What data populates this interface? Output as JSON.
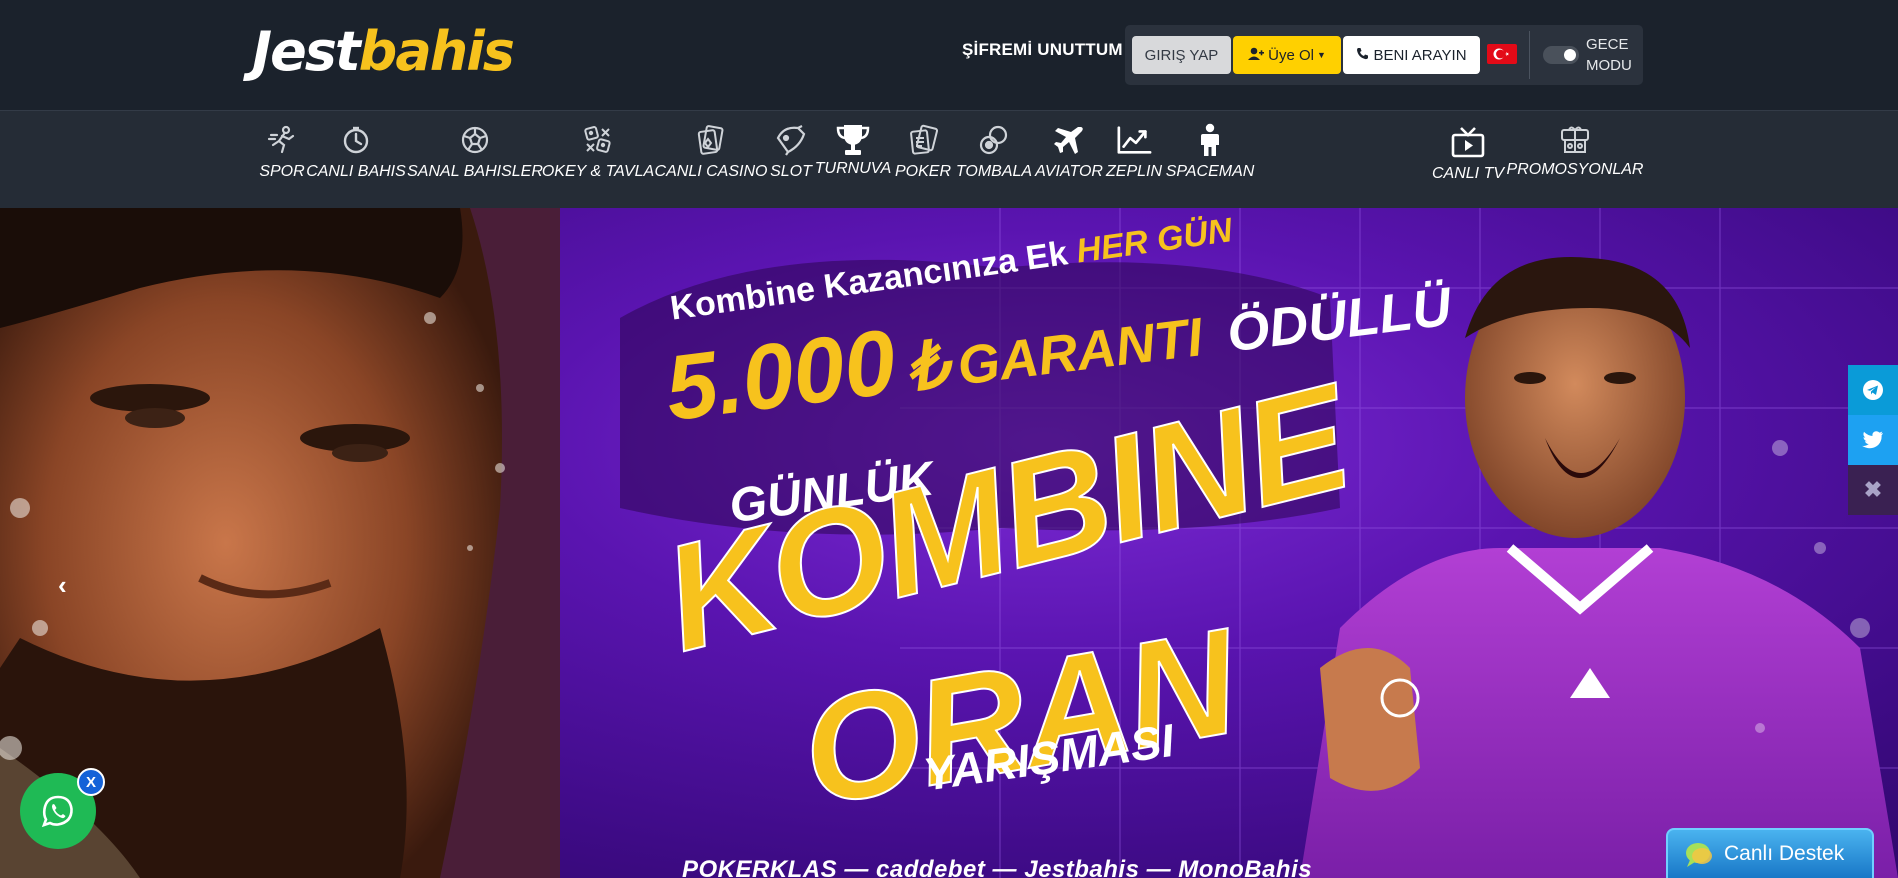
{
  "logo": {
    "part1": "Jest",
    "part2": "bahis"
  },
  "header": {
    "forgot_password": "ŞİFREMİ UNUTTUM",
    "login_label": "GIRIŞ YAP",
    "register_label": "Üye Ol",
    "call_label": "BENI ARAYIN",
    "night_mode_label": "GECE MODU"
  },
  "nav": {
    "items": [
      {
        "label": "SPOR",
        "icon": "runner-icon"
      },
      {
        "label": "CANLI BAHIS",
        "icon": "stopwatch-icon"
      },
      {
        "label": "SANAL BAHISLER",
        "icon": "soccer-ball-icon"
      },
      {
        "label": "OKEY & TAVLA",
        "icon": "dice-icon"
      },
      {
        "label": "CANLI CASINO",
        "icon": "cards-icon"
      },
      {
        "label": "SLOT",
        "icon": "slot-icon"
      },
      {
        "label": "TURNUVA",
        "icon": "trophy-icon"
      },
      {
        "label": "POKER",
        "icon": "poker-cards-icon"
      },
      {
        "label": "TOMBALA",
        "icon": "bingo-balls-icon"
      },
      {
        "label": "AVIATOR",
        "icon": "plane-icon"
      },
      {
        "label": "ZEPLIN",
        "icon": "chart-line-icon"
      },
      {
        "label": "SPACEMAN",
        "icon": "spaceman-icon"
      }
    ],
    "right_items": [
      {
        "label": "CANLI TV",
        "icon": "tv-icon"
      },
      {
        "label": "PROMOSYONLAR",
        "icon": "gift-icon"
      }
    ]
  },
  "hero": {
    "slogan_prefix": "Kombine Kazancınıza Ek",
    "slogan_highlight": "HER GÜN",
    "amount": "5.000",
    "currency": "₺",
    "guaranteed": "GARANTI",
    "rewarded": "ÖDÜLLÜ",
    "daily": "GÜNLÜK",
    "big1": "KOMBINE",
    "big2": "ORAN",
    "contest": "YARIŞMASI",
    "sponsors": "POKERKLAS — caddebet — Jestbahis — MonoBahis"
  },
  "widgets": {
    "live_support_label": "Canlı Destek",
    "whatsapp_close_label": "X"
  },
  "colors": {
    "accent_yellow": "#f7c21d",
    "header_bg": "#1b222c",
    "nav_bg": "#252c36",
    "whatsapp_green": "#1fba55",
    "telegram_blue": "#0a9bd8",
    "twitter_blue": "#1da1f2"
  }
}
